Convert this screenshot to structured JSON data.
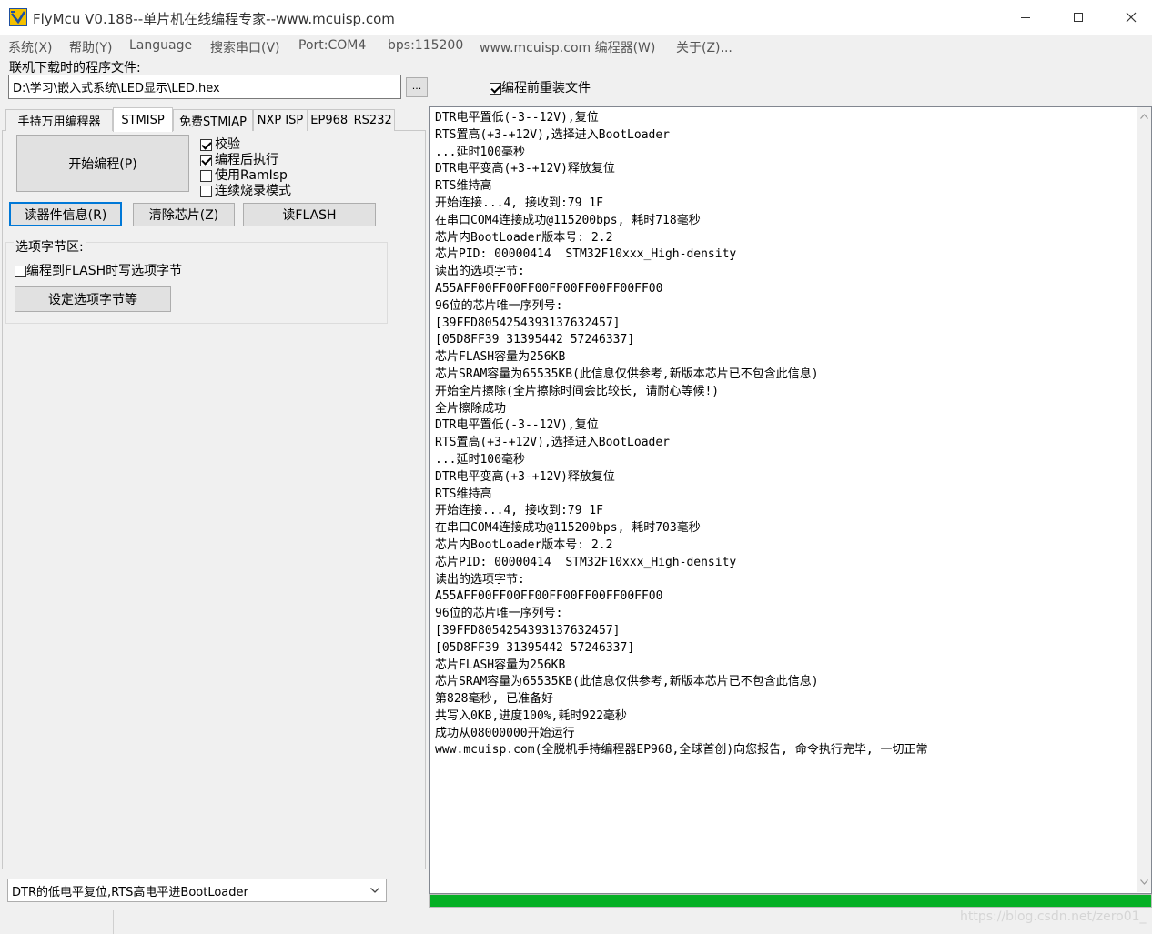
{
  "window": {
    "title": "FlyMcu V0.188--单片机在线编程专家--www.mcuisp.com"
  },
  "menu": [
    {
      "label": "系统(X)"
    },
    {
      "label": "帮助(Y)"
    },
    {
      "label": "Language"
    },
    {
      "label": "搜索串口(V)"
    },
    {
      "label": "Port:COM4"
    },
    {
      "label": "bps:115200"
    },
    {
      "label": "www.mcuisp.com 编程器(W)"
    },
    {
      "label": "关于(Z)..."
    }
  ],
  "file": {
    "label": "联机下载时的程序文件:",
    "path": "D:\\学习\\嵌入式系统\\LED显示\\LED.hex",
    "browse_label": "...",
    "reload_label": "编程前重装文件",
    "reload_checked": true
  },
  "tabs": [
    {
      "label": "手持万用编程器",
      "active": false
    },
    {
      "label": "STMISP",
      "active": true
    },
    {
      "label": "免费STMIAP",
      "active": false
    },
    {
      "label": "NXP ISP",
      "active": false
    },
    {
      "label": "EP968_RS232",
      "active": false
    }
  ],
  "stmisp": {
    "start_label": "开始编程(P)",
    "options": [
      {
        "label": "校验",
        "checked": true
      },
      {
        "label": "编程后执行",
        "checked": true
      },
      {
        "label": "使用RamIsp",
        "checked": false
      },
      {
        "label": "连续烧录模式",
        "checked": false
      }
    ],
    "read_info_label": "读器件信息(R)",
    "erase_label": "清除芯片(Z)",
    "read_flash_label": "读FLASH",
    "option_group_title": "选项字节区:",
    "write_option_label": "编程到FLASH时写选项字节",
    "write_option_checked": false,
    "set_option_label": "设定选项字节等"
  },
  "dtr_mode": "DTR的低电平复位,RTS高电平进BootLoader",
  "log": [
    "DTR电平置低(-3--12V),复位",
    "RTS置高(+3-+12V),选择进入BootLoader",
    "...延时100毫秒",
    "DTR电平变高(+3-+12V)释放复位",
    "RTS维持高",
    "开始连接...4, 接收到:79 1F",
    "在串口COM4连接成功@115200bps, 耗时718毫秒",
    "芯片内BootLoader版本号: 2.2",
    "芯片PID: 00000414  STM32F10xxx_High-density",
    "读出的选项字节:",
    "A55AFF00FF00FF00FF00FF00FF00FF00",
    "96位的芯片唯一序列号:",
    "[39FFD8054254393137632457]",
    "[05D8FF39 31395442 57246337]",
    "芯片FLASH容量为256KB",
    "芯片SRAM容量为65535KB(此信息仅供参考,新版本芯片已不包含此信息)",
    "开始全片擦除(全片擦除时间会比较长, 请耐心等候!)",
    "全片擦除成功",
    "DTR电平置低(-3--12V),复位",
    "RTS置高(+3-+12V),选择进入BootLoader",
    "...延时100毫秒",
    "DTR电平变高(+3-+12V)释放复位",
    "RTS维持高",
    "开始连接...4, 接收到:79 1F",
    "在串口COM4连接成功@115200bps, 耗时703毫秒",
    "芯片内BootLoader版本号: 2.2",
    "芯片PID: 00000414  STM32F10xxx_High-density",
    "读出的选项字节:",
    "A55AFF00FF00FF00FF00FF00FF00FF00",
    "96位的芯片唯一序列号:",
    "[39FFD8054254393137632457]",
    "[05D8FF39 31395442 57246337]",
    "芯片FLASH容量为256KB",
    "芯片SRAM容量为65535KB(此信息仅供参考,新版本芯片已不包含此信息)",
    "第828毫秒, 已准备好",
    "共写入0KB,进度100%,耗时922毫秒",
    "成功从08000000开始运行",
    "www.mcuisp.com(全脱机手持编程器EP968,全球首创)向您报告, 命令执行完毕, 一切正常"
  ],
  "progress": 1.0,
  "colors": {
    "progress": "#06b025",
    "focus_border": "#0078d7"
  },
  "watermark": "https://blog.csdn.net/zero01_"
}
